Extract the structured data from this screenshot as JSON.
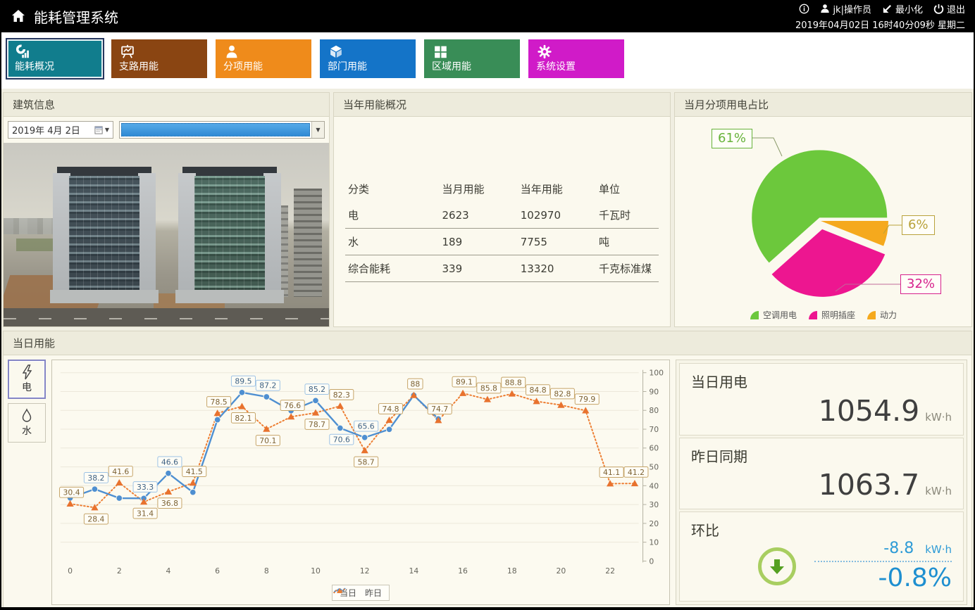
{
  "app": {
    "title": "能耗管理系统",
    "user": "jk|操作员",
    "minimize_label": "最小化",
    "logout_label": "退出",
    "datetime": "2019年04月02日 16时40分09秒 星期二"
  },
  "nav": {
    "items": [
      {
        "label": "能耗概况",
        "color": "#117D8D",
        "selected": true
      },
      {
        "label": "支路用能",
        "color": "#8A4512",
        "selected": false
      },
      {
        "label": "分项用能",
        "color": "#EF8B1B",
        "selected": false
      },
      {
        "label": "部门用能",
        "color": "#1474C8",
        "selected": false
      },
      {
        "label": "区域用能",
        "color": "#398D57",
        "selected": false
      },
      {
        "label": "系统设置",
        "color": "#D01BC8",
        "selected": false
      }
    ]
  },
  "building_panel": {
    "title": "建筑信息",
    "date_value": "2019年 4月 2日"
  },
  "year_panel": {
    "title": "当年用能概况",
    "table": {
      "headers": [
        "分类",
        "当月用能",
        "当年用能",
        "单位"
      ],
      "rows": [
        [
          "电",
          "2623",
          "102970",
          "千瓦时"
        ],
        [
          "水",
          "189",
          "7755",
          "吨"
        ],
        [
          "综合能耗",
          "339",
          "13320",
          "千克标准煤"
        ]
      ]
    }
  },
  "pie_panel": {
    "title": "当月分项用电占比"
  },
  "daily_panel": {
    "title": "当日用能",
    "energy_buttons": [
      {
        "label": "电",
        "selected": true
      },
      {
        "label": "水",
        "selected": false
      }
    ],
    "stats": [
      {
        "label": "当日用电",
        "value": "1054.9",
        "unit": "kW·h"
      },
      {
        "label": "昨日同期",
        "value": "1063.7",
        "unit": "kW·h"
      }
    ],
    "ratio": {
      "label": "环比",
      "delta": "-8.8",
      "delta_unit": "kW·h",
      "percent": "-0.8%"
    }
  },
  "chart_data": [
    {
      "type": "pie",
      "title": "当月分项用电占比",
      "unit": "%",
      "legend_position": "bottom",
      "slices": [
        {
          "label": "空调用电",
          "value": 61,
          "pct_label": "61%",
          "color": "#6CC83C",
          "callout_color": "#67B33B",
          "exploded": false
        },
        {
          "label": "照明插座",
          "value": 32,
          "pct_label": "32%",
          "color": "#ED1690",
          "callout_color": "#D6218C",
          "exploded": true
        },
        {
          "label": "动力",
          "value": 6,
          "pct_label": "6%",
          "color": "#F5A91D",
          "callout_color": "#B9A23B",
          "exploded": false
        }
      ]
    },
    {
      "type": "line",
      "title": "当日用能",
      "xlabel": "",
      "ylabel": "",
      "ylim": [
        0,
        100
      ],
      "y_tick_step": 10,
      "x_ticks": [
        0,
        2,
        4,
        6,
        8,
        10,
        12,
        14,
        16,
        18,
        20,
        22
      ],
      "legend_position": "bottom",
      "series": [
        {
          "name": "当日",
          "color": "#4E8FD1",
          "line_style": "solid",
          "marker": "circle",
          "x_start": 0,
          "values": [
            33.5,
            38.2,
            33.4,
            33.3,
            46.6,
            36.5,
            75.0,
            89.5,
            87.2,
            79.8,
            85.2,
            70.6,
            65.6,
            69.9,
            88,
            75.5
          ],
          "labeled": [
            false,
            true,
            false,
            true,
            true,
            false,
            false,
            true,
            true,
            false,
            true,
            true,
            true,
            false,
            false,
            false
          ],
          "label_border": "#9CC2E5",
          "label_text_color": "#3E6284"
        },
        {
          "name": "昨日",
          "color": "#ED7D31",
          "line_style": "dotted",
          "marker": "triangle",
          "x_start": 0,
          "values": [
            30.4,
            28.4,
            41.6,
            31.4,
            36.8,
            41.5,
            78.5,
            82.1,
            70.1,
            76.6,
            78.7,
            82.3,
            58.7,
            74.8,
            88,
            74.7,
            89.1,
            85.8,
            88.8,
            84.8,
            82.8,
            79.9,
            41.1,
            41.2
          ],
          "labeled": [
            true,
            true,
            true,
            true,
            true,
            true,
            true,
            true,
            true,
            true,
            true,
            true,
            true,
            true,
            true,
            true,
            true,
            true,
            true,
            true,
            true,
            true,
            true,
            true
          ],
          "label_border": "#C5A468",
          "label_text_color": "#7C6234"
        }
      ]
    }
  ]
}
